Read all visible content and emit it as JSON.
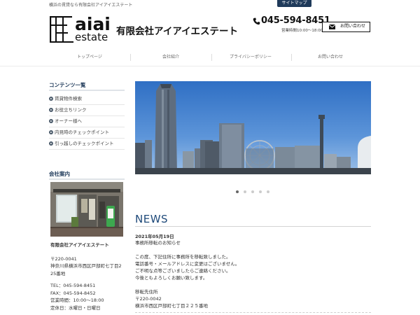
{
  "header": {
    "tagline": "横浜の賃貸なら有限会社アイアイエステート",
    "sitemap_label": "サイトマップ",
    "logo_text_top": "aiai",
    "logo_text_bottom": "estate",
    "company_name": "有限会社アイアイエステート",
    "phone": "045-594-8451",
    "hours": "営業時間10:00～18:00",
    "contact_label": "お問い合わせ"
  },
  "nav": {
    "items": [
      {
        "label": "トップページ"
      },
      {
        "label": "会社紹介"
      },
      {
        "label": "プライバシーポリシー"
      },
      {
        "label": "お問い合わせ"
      }
    ]
  },
  "sidebar": {
    "contents_title": "コンテンツ一覧",
    "items": [
      {
        "label": "賃貸物件検索"
      },
      {
        "label": "お役立ちリンク"
      },
      {
        "label": "オーナー様へ"
      },
      {
        "label": "内見時のチェックポイント"
      },
      {
        "label": "引っ越しのチェックポイント"
      }
    ],
    "company_title": "会社案内",
    "company": {
      "name": "有限会社アイアイエステート",
      "postal": "〒220-0041",
      "address_1": "神奈川県横浜市西区戸部町七丁目2",
      "address_2": "25番地",
      "tel": "TEL：045-594-8451",
      "fax": "FAX：045-594-8452",
      "hours": "営業時間：10:00～18:00",
      "holidays": "定休日：水曜日・日曜日"
    }
  },
  "slider": {
    "slide_count": 5,
    "active_index": 0
  },
  "news": {
    "title": "NEWS",
    "date": "2021年05月19日",
    "heading": "事務所移転のお知らせ",
    "lines": [
      "この度、下記住所に事務所を移転致しました。",
      "電話番号・メールアドレスに変更はございません。",
      "ご不明な点等ございましたらご連絡ください。",
      "今後ともよろしくお願い致します。"
    ],
    "new_address_label": "移転先住所",
    "new_postal": "〒220-0042",
    "new_address": "横浜市西区戸部町七丁目２２５番地"
  },
  "colors": {
    "accent_navy": "#1f3a5a",
    "news_blue": "#1f4a7a"
  },
  "icons": {
    "phone": "phone-icon",
    "mail": "mail-icon",
    "bullet": "circle-arrow-icon"
  }
}
